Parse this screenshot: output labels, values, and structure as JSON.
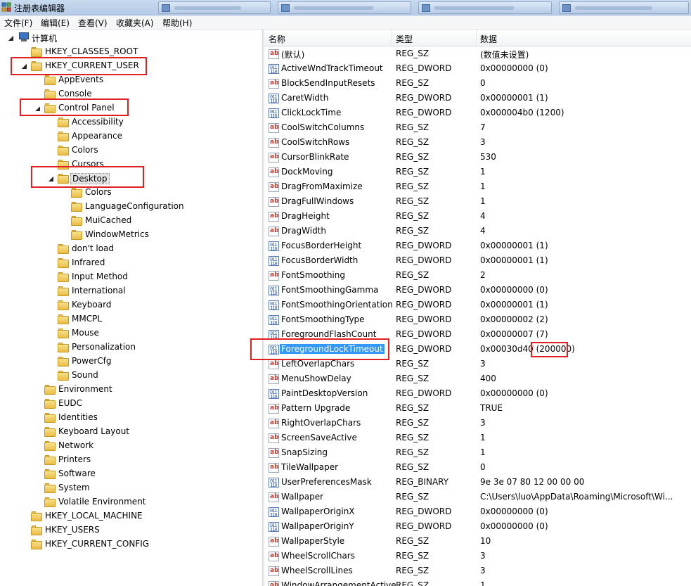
{
  "window": {
    "title": "注册表编辑器",
    "icon": "regedit-icon"
  },
  "menu": {
    "items": [
      "文件(F)",
      "编辑(E)",
      "查看(V)",
      "收藏夹(A)",
      "帮助(H)"
    ]
  },
  "tree": {
    "root": "计算机",
    "nodes": [
      {
        "label": "HKEY_CLASSES_ROOT",
        "state": "collapsed"
      },
      {
        "label": "HKEY_CURRENT_USER",
        "state": "expanded"
      },
      {
        "label": "AppEvents",
        "state": "collapsed"
      },
      {
        "label": "Console",
        "state": "none"
      },
      {
        "label": "Control Panel",
        "state": "expanded"
      },
      {
        "label": "Accessibility",
        "state": "collapsed"
      },
      {
        "label": "Appearance",
        "state": "collapsed"
      },
      {
        "label": "Colors",
        "state": "none"
      },
      {
        "label": "Cursors",
        "state": "none"
      },
      {
        "label": "Desktop",
        "state": "expanded",
        "selected": true
      },
      {
        "label": "Colors",
        "state": "none"
      },
      {
        "label": "LanguageConfiguration",
        "state": "none"
      },
      {
        "label": "MuiCached",
        "state": "none"
      },
      {
        "label": "WindowMetrics",
        "state": "none"
      },
      {
        "label": "don't load",
        "state": "none"
      },
      {
        "label": "Infrared",
        "state": "collapsed"
      },
      {
        "label": "Input Method",
        "state": "collapsed"
      },
      {
        "label": "International",
        "state": "collapsed"
      },
      {
        "label": "Keyboard",
        "state": "none"
      },
      {
        "label": "MMCPL",
        "state": "none"
      },
      {
        "label": "Mouse",
        "state": "none"
      },
      {
        "label": "Personalization",
        "state": "collapsed"
      },
      {
        "label": "PowerCfg",
        "state": "collapsed"
      },
      {
        "label": "Sound",
        "state": "none"
      },
      {
        "label": "Environment",
        "state": "none"
      },
      {
        "label": "EUDC",
        "state": "collapsed"
      },
      {
        "label": "Identities",
        "state": "collapsed"
      },
      {
        "label": "Keyboard Layout",
        "state": "collapsed"
      },
      {
        "label": "Network",
        "state": "none"
      },
      {
        "label": "Printers",
        "state": "collapsed"
      },
      {
        "label": "Software",
        "state": "collapsed"
      },
      {
        "label": "System",
        "state": "collapsed"
      },
      {
        "label": "Volatile Environment",
        "state": "collapsed"
      },
      {
        "label": "HKEY_LOCAL_MACHINE",
        "state": "collapsed"
      },
      {
        "label": "HKEY_USERS",
        "state": "collapsed"
      },
      {
        "label": "HKEY_CURRENT_CONFIG",
        "state": "collapsed"
      }
    ]
  },
  "list": {
    "columns": [
      "名称",
      "类型",
      "数据"
    ],
    "rows": [
      {
        "name": "(默认)",
        "type": "REG_SZ",
        "data": "(数值未设置)",
        "icon": "string-value-icon"
      },
      {
        "name": "ActiveWndTrackTimeout",
        "type": "REG_DWORD",
        "data": "0x00000000 (0)",
        "icon": "binary-value-icon"
      },
      {
        "name": "BlockSendInputResets",
        "type": "REG_SZ",
        "data": "0",
        "icon": "string-value-icon"
      },
      {
        "name": "CaretWidth",
        "type": "REG_DWORD",
        "data": "0x00000001 (1)",
        "icon": "binary-value-icon"
      },
      {
        "name": "ClickLockTime",
        "type": "REG_DWORD",
        "data": "0x000004b0 (1200)",
        "icon": "binary-value-icon"
      },
      {
        "name": "CoolSwitchColumns",
        "type": "REG_SZ",
        "data": "7",
        "icon": "string-value-icon"
      },
      {
        "name": "CoolSwitchRows",
        "type": "REG_SZ",
        "data": "3",
        "icon": "string-value-icon"
      },
      {
        "name": "CursorBlinkRate",
        "type": "REG_SZ",
        "data": "530",
        "icon": "string-value-icon"
      },
      {
        "name": "DockMoving",
        "type": "REG_SZ",
        "data": "1",
        "icon": "string-value-icon"
      },
      {
        "name": "DragFromMaximize",
        "type": "REG_SZ",
        "data": "1",
        "icon": "string-value-icon"
      },
      {
        "name": "DragFullWindows",
        "type": "REG_SZ",
        "data": "1",
        "icon": "string-value-icon"
      },
      {
        "name": "DragHeight",
        "type": "REG_SZ",
        "data": "4",
        "icon": "string-value-icon"
      },
      {
        "name": "DragWidth",
        "type": "REG_SZ",
        "data": "4",
        "icon": "string-value-icon"
      },
      {
        "name": "FocusBorderHeight",
        "type": "REG_DWORD",
        "data": "0x00000001 (1)",
        "icon": "binary-value-icon"
      },
      {
        "name": "FocusBorderWidth",
        "type": "REG_DWORD",
        "data": "0x00000001 (1)",
        "icon": "binary-value-icon"
      },
      {
        "name": "FontSmoothing",
        "type": "REG_SZ",
        "data": "2",
        "icon": "string-value-icon"
      },
      {
        "name": "FontSmoothingGamma",
        "type": "REG_DWORD",
        "data": "0x00000000 (0)",
        "icon": "binary-value-icon"
      },
      {
        "name": "FontSmoothingOrientation",
        "type": "REG_DWORD",
        "data": "0x00000001 (1)",
        "icon": "binary-value-icon"
      },
      {
        "name": "FontSmoothingType",
        "type": "REG_DWORD",
        "data": "0x00000002 (2)",
        "icon": "binary-value-icon"
      },
      {
        "name": "ForegroundFlashCount",
        "type": "REG_DWORD",
        "data": "0x00000007 (7)",
        "icon": "binary-value-icon"
      },
      {
        "name": "ForegroundLockTimeout",
        "type": "REG_DWORD",
        "data": "0x00030d40 (200000)",
        "icon": "binary-value-icon",
        "selected": true
      },
      {
        "name": "LeftOverlapChars",
        "type": "REG_SZ",
        "data": "3",
        "icon": "string-value-icon"
      },
      {
        "name": "MenuShowDelay",
        "type": "REG_SZ",
        "data": "400",
        "icon": "string-value-icon"
      },
      {
        "name": "PaintDesktopVersion",
        "type": "REG_DWORD",
        "data": "0x00000000 (0)",
        "icon": "binary-value-icon"
      },
      {
        "name": "Pattern Upgrade",
        "type": "REG_SZ",
        "data": "TRUE",
        "icon": "string-value-icon"
      },
      {
        "name": "RightOverlapChars",
        "type": "REG_SZ",
        "data": "3",
        "icon": "string-value-icon"
      },
      {
        "name": "ScreenSaveActive",
        "type": "REG_SZ",
        "data": "1",
        "icon": "string-value-icon"
      },
      {
        "name": "SnapSizing",
        "type": "REG_SZ",
        "data": "1",
        "icon": "string-value-icon"
      },
      {
        "name": "TileWallpaper",
        "type": "REG_SZ",
        "data": "0",
        "icon": "string-value-icon"
      },
      {
        "name": "UserPreferencesMask",
        "type": "REG_BINARY",
        "data": "9e 3e 07 80 12 00 00 00",
        "icon": "binary-value-icon"
      },
      {
        "name": "Wallpaper",
        "type": "REG_SZ",
        "data": "C:\\Users\\luo\\AppData\\Roaming\\Microsoft\\Wi...",
        "icon": "string-value-icon"
      },
      {
        "name": "WallpaperOriginX",
        "type": "REG_DWORD",
        "data": "0x00000000 (0)",
        "icon": "binary-value-icon"
      },
      {
        "name": "WallpaperOriginY",
        "type": "REG_DWORD",
        "data": "0x00000000 (0)",
        "icon": "binary-value-icon"
      },
      {
        "name": "WallpaperStyle",
        "type": "REG_SZ",
        "data": "10",
        "icon": "string-value-icon"
      },
      {
        "name": "WheelScrollChars",
        "type": "REG_SZ",
        "data": "3",
        "icon": "string-value-icon"
      },
      {
        "name": "WheelScrollLines",
        "type": "REG_SZ",
        "data": "3",
        "icon": "string-value-icon"
      },
      {
        "name": "WindowArrangementActive",
        "type": "REG_SZ",
        "data": "1",
        "icon": "string-value-icon"
      }
    ]
  },
  "colors": {
    "selection": "#3399ff",
    "annotation": "#e02020"
  }
}
